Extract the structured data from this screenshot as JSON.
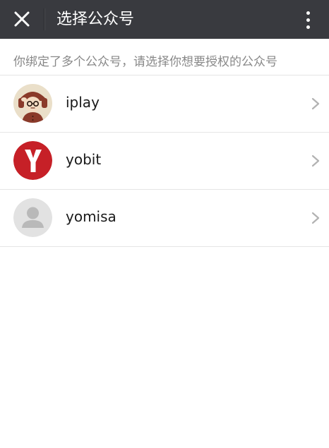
{
  "header": {
    "title": "选择公众号",
    "close_icon": "close-icon",
    "more_icon": "more-vertical-icon",
    "background": "#393a3f"
  },
  "hint": {
    "text": "你绑定了多个公众号，请选择你想要授权的公众号"
  },
  "accounts": [
    {
      "name": "iplay",
      "avatar": "cartoon-character-avatar"
    },
    {
      "name": "yobit",
      "avatar": "red-y-logo-avatar"
    },
    {
      "name": "yomisa",
      "avatar": "default-person-avatar"
    }
  ],
  "colors": {
    "brand_red": "#c62027",
    "divider": "#e5e5e5",
    "hint_text": "#888888"
  }
}
